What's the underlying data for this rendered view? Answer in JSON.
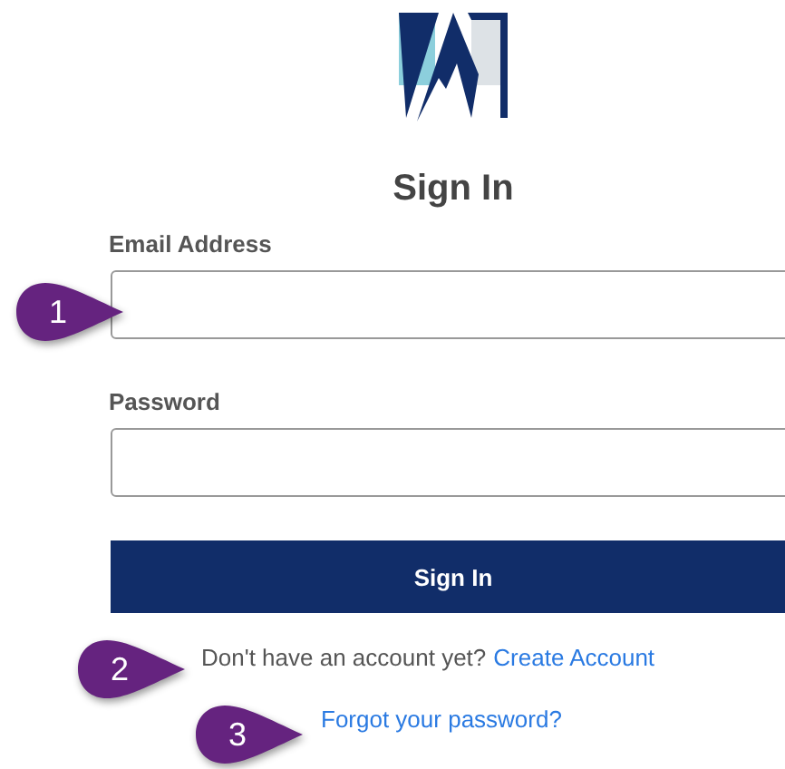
{
  "title": "Sign In",
  "fields": [
    {
      "label": "Email Address"
    },
    {
      "label": "Password"
    }
  ],
  "submit": "Sign In",
  "signup": {
    "prompt": "Don't have an account yet?",
    "link": "Create Account"
  },
  "forgot": "Forgot your password?",
  "callouts": [
    "1",
    "2",
    "3"
  ]
}
